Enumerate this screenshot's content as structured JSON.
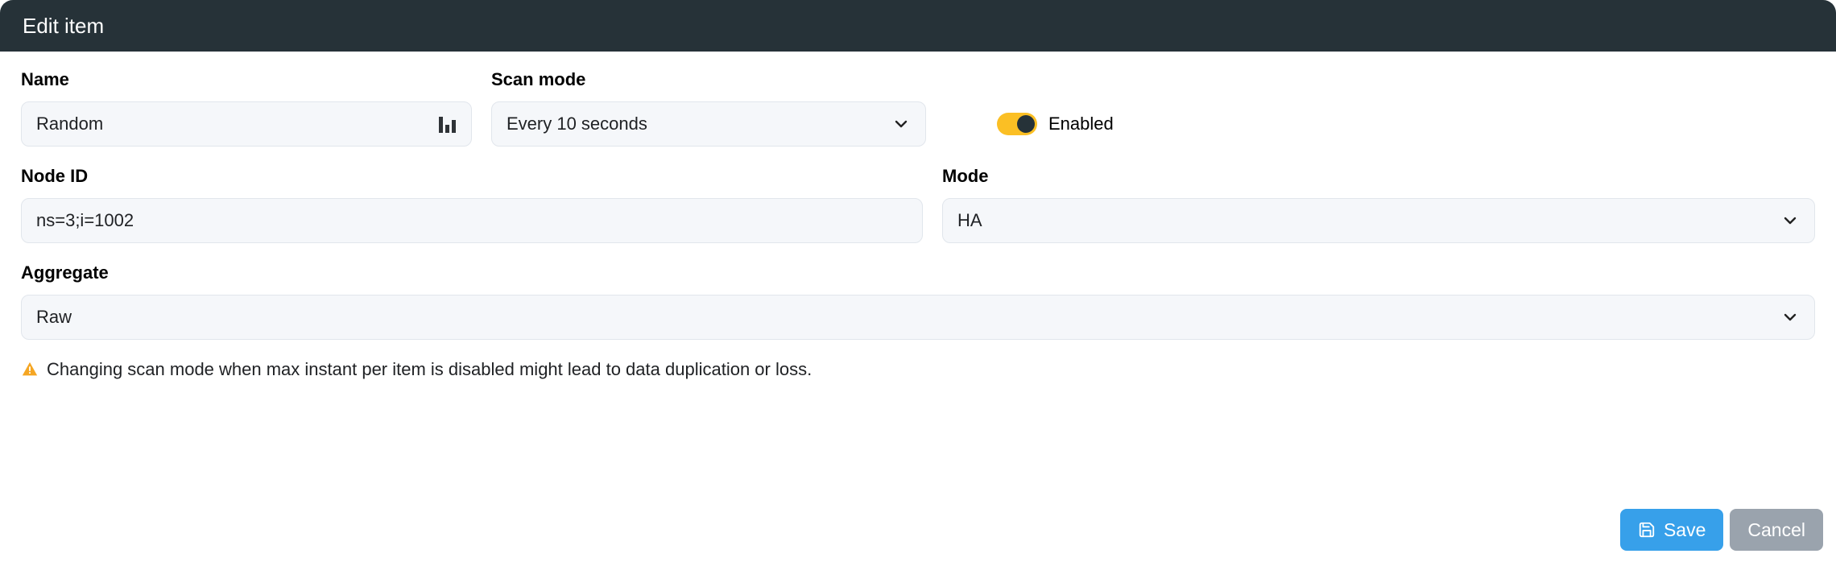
{
  "header": {
    "title": "Edit item"
  },
  "name": {
    "label": "Name",
    "value": "Random"
  },
  "scanMode": {
    "label": "Scan mode",
    "value": "Every 10 seconds"
  },
  "enabled": {
    "label": "Enabled",
    "on": true
  },
  "nodeId": {
    "label": "Node ID",
    "value": "ns=3;i=1002"
  },
  "mode": {
    "label": "Mode",
    "value": "HA"
  },
  "aggregate": {
    "label": "Aggregate",
    "value": "Raw"
  },
  "warning": {
    "text": "Changing scan mode when max instant per item is disabled might lead to data duplication or loss."
  },
  "buttons": {
    "save": "Save",
    "cancel": "Cancel"
  }
}
